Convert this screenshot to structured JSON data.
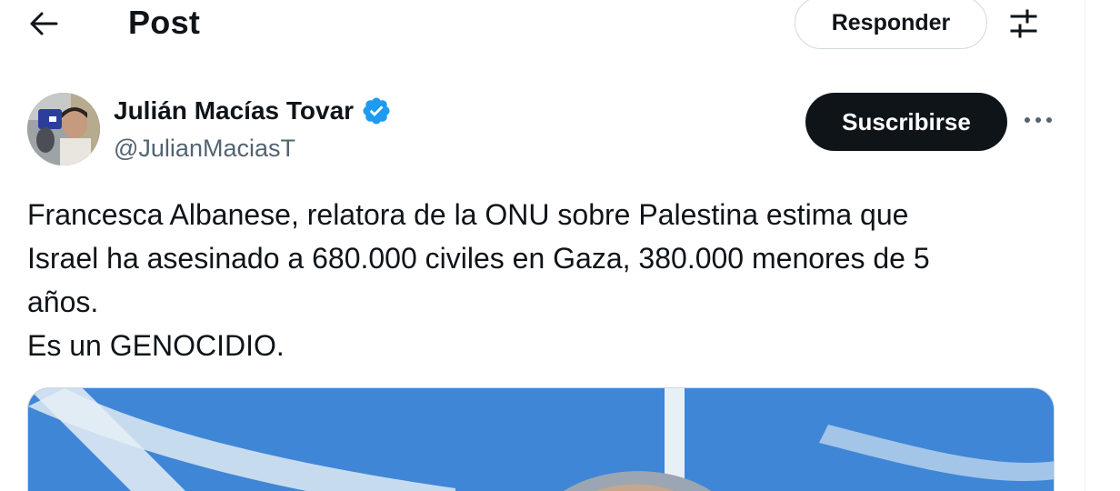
{
  "header": {
    "title": "Post",
    "back_icon": "arrow-left-icon",
    "reply_label": "Responder",
    "filter_icon": "sliders-icon"
  },
  "post": {
    "author": {
      "name": "Julián Macías Tovar",
      "handle": "@JulianMaciasT",
      "verified": true,
      "verified_color": "#1d9bf0"
    },
    "subscribe_label": "Suscribirse",
    "more_icon": "more-horizontal-icon",
    "text_lines": [
      "Francesca Albanese, relatora de la ONU sobre Palestina estima que",
      "Israel ha asesinado a 680.000 civiles en Gaza, 380.000 menores de 5",
      "años.",
      "Es un GENOCIDIO."
    ]
  },
  "colors": {
    "text": "#0f1419",
    "secondary": "#536471",
    "border": "#cfd9de",
    "media_blue": "#3f86d6"
  }
}
